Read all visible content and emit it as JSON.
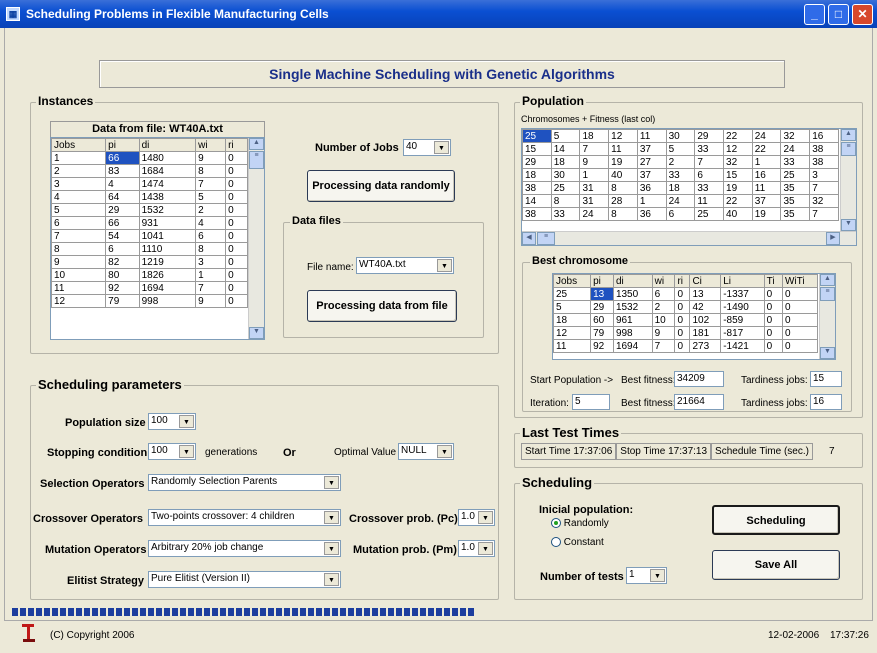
{
  "window": {
    "title": "Scheduling Problems in Flexible Manufacturing Cells"
  },
  "header": {
    "title": "Single Machine Scheduling with Genetic Algorithms"
  },
  "instances": {
    "label": "Instances",
    "table_title": "Data from file: WT40A.txt",
    "columns": [
      "Jobs",
      "pi",
      "di",
      "wi",
      "ri"
    ],
    "rows": [
      [
        "1",
        "66",
        "1480",
        "9",
        "0"
      ],
      [
        "2",
        "83",
        "1684",
        "8",
        "0"
      ],
      [
        "3",
        "4",
        "1474",
        "7",
        "0"
      ],
      [
        "4",
        "64",
        "1438",
        "5",
        "0"
      ],
      [
        "5",
        "29",
        "1532",
        "2",
        "0"
      ],
      [
        "6",
        "66",
        "931",
        "4",
        "0"
      ],
      [
        "7",
        "54",
        "1041",
        "6",
        "0"
      ],
      [
        "8",
        "6",
        "1110",
        "8",
        "0"
      ],
      [
        "9",
        "82",
        "1219",
        "3",
        "0"
      ],
      [
        "10",
        "80",
        "1826",
        "1",
        "0"
      ],
      [
        "11",
        "92",
        "1694",
        "7",
        "0"
      ],
      [
        "12",
        "79",
        "998",
        "9",
        "0"
      ]
    ],
    "num_jobs_label": "Number of Jobs",
    "num_jobs_value": "40",
    "random_button": "Processing data randomly",
    "data_files_label": "Data files",
    "file_name_label": "File name:",
    "file_name_value": "WT40A.txt",
    "file_button": "Processing data from file"
  },
  "params": {
    "label": "Scheduling parameters",
    "population_size_label": "Population size",
    "population_size_value": "100",
    "stopping_label": "Stopping condition",
    "stopping_value": "100",
    "generations_label": "generations",
    "or_label": "Or",
    "optimal_label": "Optimal Value",
    "optimal_value": "NULL",
    "selection_label": "Selection Operators",
    "selection_value": "Randomly Selection Parents",
    "crossover_label": "Crossover Operators",
    "crossover_value": "Two-points crossover: 4 children",
    "crossover_prob_label": "Crossover prob. (Pc)",
    "crossover_prob_value": "1.0",
    "mutation_label": "Mutation Operators",
    "mutation_value": "Arbitrary 20% job change",
    "mutation_prob_label": "Mutation prob. (Pm)",
    "mutation_prob_value": "1.0",
    "elitist_label": "Elitist Strategy",
    "elitist_value": "Pure Elitist (Version II)"
  },
  "population": {
    "label": "Population",
    "sub_label": "Chromosomes + Fitness (last col)",
    "rows": [
      [
        "25",
        "5",
        "18",
        "12",
        "11",
        "30",
        "29",
        "22",
        "24",
        "32",
        "16"
      ],
      [
        "15",
        "14",
        "7",
        "11",
        "37",
        "5",
        "33",
        "12",
        "22",
        "24",
        "38"
      ],
      [
        "29",
        "18",
        "9",
        "19",
        "27",
        "2",
        "7",
        "32",
        "1",
        "33",
        "38"
      ],
      [
        "18",
        "30",
        "1",
        "40",
        "37",
        "33",
        "6",
        "15",
        "16",
        "25",
        "3"
      ],
      [
        "38",
        "25",
        "31",
        "8",
        "36",
        "18",
        "33",
        "19",
        "11",
        "35",
        "7"
      ],
      [
        "14",
        "8",
        "31",
        "28",
        "1",
        "24",
        "11",
        "22",
        "37",
        "35",
        "32"
      ],
      [
        "38",
        "33",
        "24",
        "8",
        "36",
        "6",
        "25",
        "40",
        "19",
        "35",
        "7"
      ]
    ],
    "best_label": "Best chromosome",
    "best_columns": [
      "Jobs",
      "pi",
      "di",
      "wi",
      "ri",
      "Ci",
      "Li",
      "Ti",
      "WiTi"
    ],
    "best_rows": [
      [
        "25",
        "13",
        "1350",
        "6",
        "0",
        "13",
        "-1337",
        "0",
        "0"
      ],
      [
        "5",
        "29",
        "1532",
        "2",
        "0",
        "42",
        "-1490",
        "0",
        "0"
      ],
      [
        "18",
        "60",
        "961",
        "10",
        "0",
        "102",
        "-859",
        "0",
        "0"
      ],
      [
        "12",
        "79",
        "998",
        "9",
        "0",
        "181",
        "-817",
        "0",
        "0"
      ],
      [
        "11",
        "92",
        "1694",
        "7",
        "0",
        "273",
        "-1421",
        "0",
        "0"
      ]
    ],
    "start_population_label": "Start Population ->",
    "best_fitness_label": "Best fitness:",
    "start_best_fitness": "34209",
    "tardiness_label": "Tardiness jobs:",
    "start_tardiness": "15",
    "iteration_label": "Iteration:",
    "iteration_value": "5",
    "iter_best_fitness": "21664",
    "iter_tardiness": "16"
  },
  "times": {
    "label": "Last Test Times",
    "start_label": "Start Time",
    "start_value": "17:37:06",
    "stop_label": "Stop Time",
    "stop_value": "17:37:13",
    "schedule_label": "Schedule Time (sec.)",
    "schedule_value": "7"
  },
  "scheduling": {
    "label": "Scheduling",
    "initial_label": "Inicial population:",
    "randomly_label": "Randomly",
    "constant_label": "Constant",
    "schedule_button": "Scheduling",
    "save_button": "Save All",
    "tests_label": "Number of tests",
    "tests_value": "1"
  },
  "status": {
    "copyright": "(C) Copyright  2006",
    "date": "12-02-2006",
    "time": "17:37:26"
  },
  "colors": {
    "selection": "#1f52c0",
    "titlebar": "#0a4fd2",
    "header_text": "#1a2f8a"
  }
}
